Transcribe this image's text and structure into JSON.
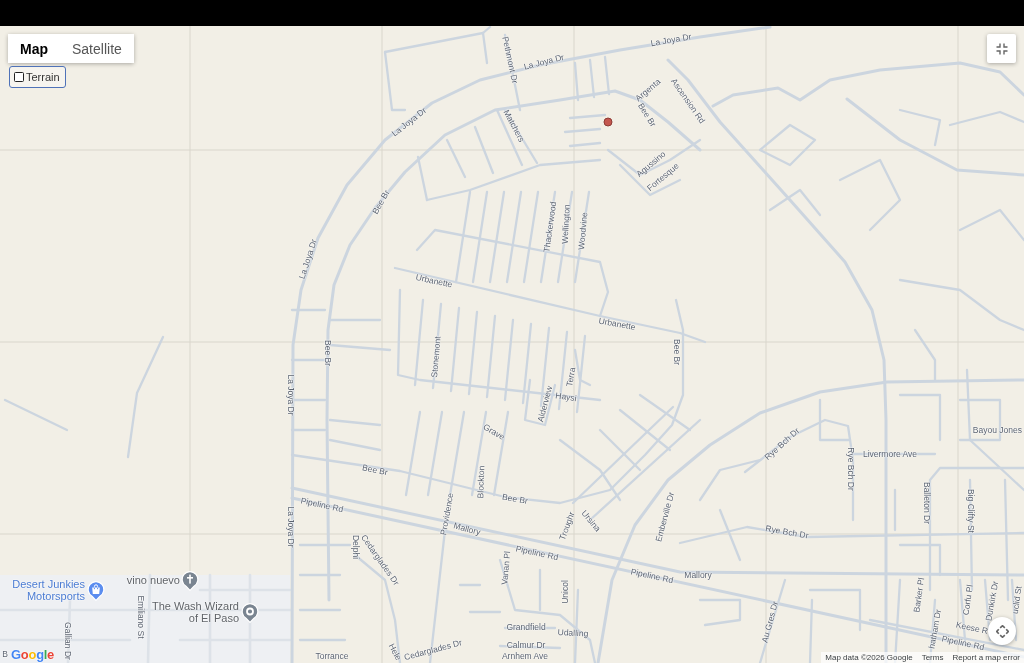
{
  "map_type_control": {
    "tabs": [
      {
        "label": "Map",
        "selected": true
      },
      {
        "label": "Satellite",
        "selected": false
      }
    ],
    "terrain": {
      "label": "Terrain",
      "checked": false
    }
  },
  "map": {
    "street_labels": [
      "La Joya Dr",
      "Pethmont Dr",
      "La Joya Dr",
      "Argenta",
      "Ascension Rd",
      "Bee Br",
      "La Joya Dr",
      "Matchers",
      "Agussino",
      "Fortesque",
      "Bee Br",
      "Thackerwood",
      "Wellington",
      "Woodvine",
      "La Joya Dr",
      "Urbanette",
      "Urbanette",
      "Bee Br",
      "Bee Br",
      "Stonemont",
      "Terra",
      "La Joya Dr",
      "Haysi",
      "Alderview",
      "Bayou Jones",
      "Grave",
      "Rye Bch Dr",
      "Livermore Ave",
      "Rye Bch Dr",
      "Bee Br",
      "Blockton",
      "Bee Br",
      "Balleton Dr",
      "Pipeline Rd",
      "Big Clifty St",
      "Providence",
      "Emberville Dr",
      "Ursina",
      "Troughr",
      "La Joya Dr",
      "Mallory",
      "Rye Bch Dr",
      "Delphi",
      "Pipeline Rd",
      "Cedarglades Dr",
      "Vanan Pl",
      "Mallory",
      "Pipeline Rd",
      "Unicol",
      "Barker Pl",
      "Corfu Pl",
      "Dunkirk Dr",
      "uclid St",
      "Emiliano St",
      "Au Gres Dr",
      "Grandfield",
      "Keese R",
      "hatham Dr",
      "Gallian Dr",
      "Udalling",
      "Pipeline Rd",
      "Calmur Dr",
      "B",
      "Cedarglades Dr",
      "Hele",
      "Torrance",
      "Arnhem Ave"
    ],
    "places": [
      {
        "name": "vino nuevo",
        "kind": "church"
      },
      {
        "name": "Desert Junkies Motorsports",
        "kind": "shopping"
      },
      {
        "name": "The Wash Wizard of El Paso",
        "kind": "generic"
      }
    ]
  },
  "attribution": {
    "logo": "Google",
    "map_data": "Map data ©2026 Google",
    "terms": "Terms",
    "report": "Report a map error"
  }
}
